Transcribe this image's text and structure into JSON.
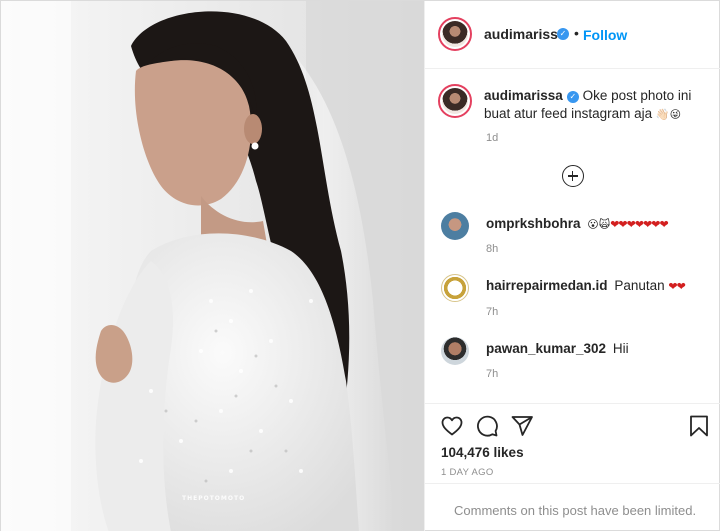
{
  "post": {
    "username": "audimarissa",
    "follow_label": "Follow",
    "separator": "•",
    "watermark": "THEPOTOMOTO",
    "verified_glyph": "✓"
  },
  "caption": {
    "username": "audimarissa",
    "text": "Oke post photo ini buat atur feed instagram aja",
    "emoji": "👋🏻😜",
    "time": "1d"
  },
  "comments": [
    {
      "username": "omprkshbohra",
      "text": "😮🙀",
      "hearts": "❤❤❤❤❤❤❤",
      "time": "8h"
    },
    {
      "username": "hairrepairmedan.id",
      "text": "Panutan",
      "hearts": "❤❤",
      "time": "7h"
    },
    {
      "username": "pawan_kumar_302",
      "text": "Hii",
      "hearts": "",
      "time": "7h"
    }
  ],
  "actions": {
    "icons": [
      "heart-icon",
      "comment-icon",
      "share-icon",
      "bookmark-icon"
    ],
    "likes": "104,476 likes",
    "date": "1 DAY AGO"
  },
  "footer": {
    "limited_text": "Comments on this post have been limited."
  },
  "colors": {
    "accent": "#0095f6",
    "verified": "#3897f0",
    "heart": "#d31f1f",
    "muted": "#8e8e8e"
  }
}
